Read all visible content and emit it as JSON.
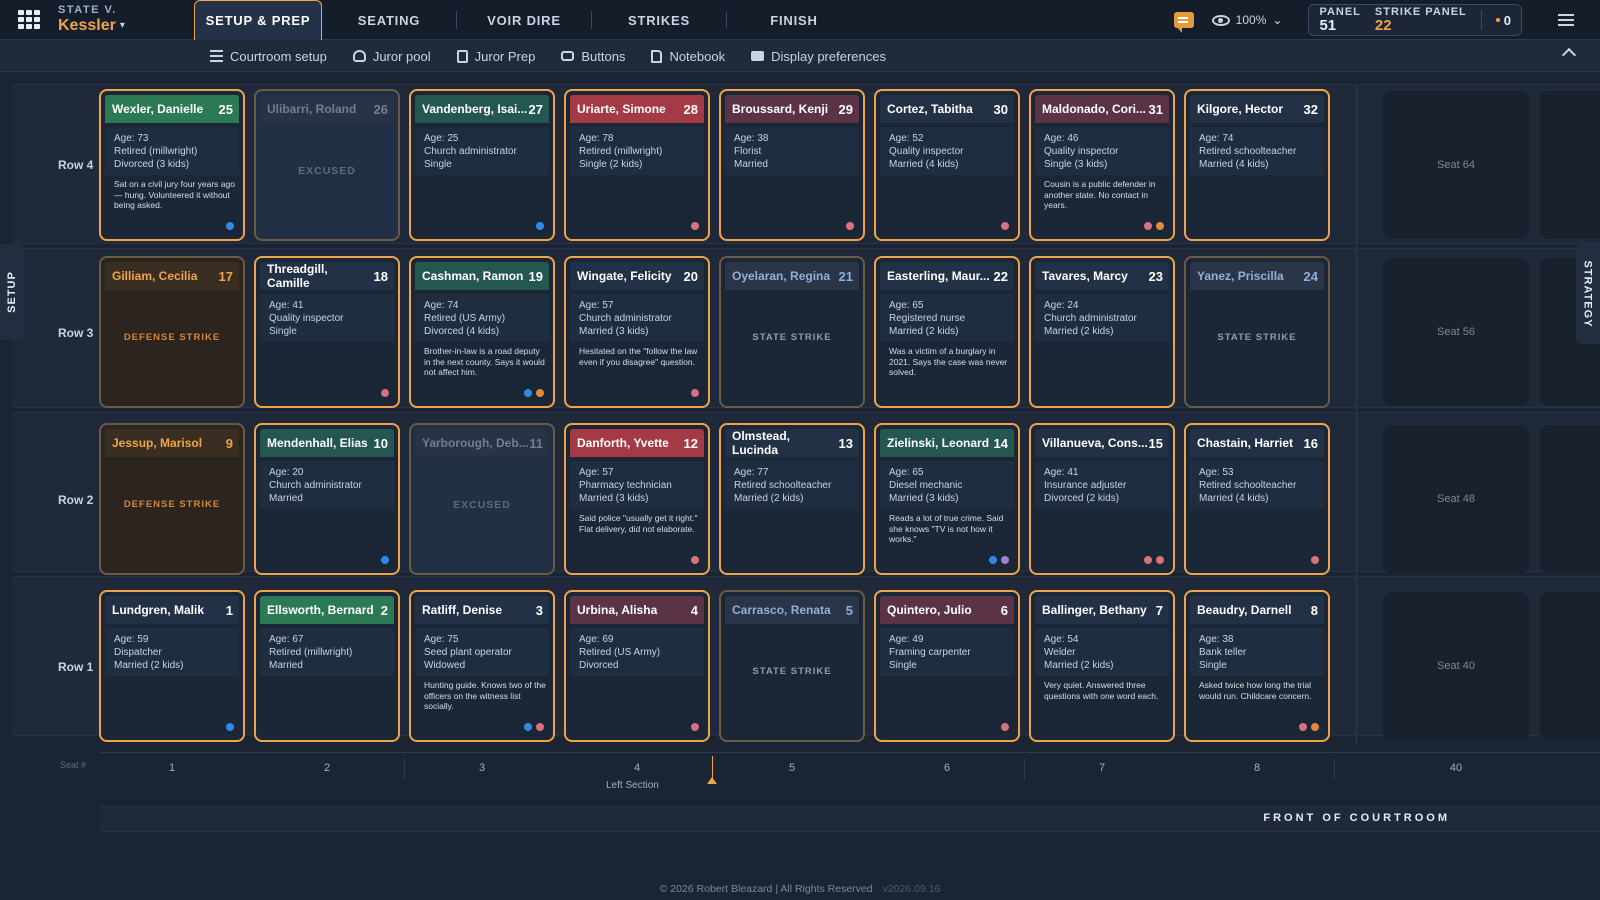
{
  "case": {
    "kicker": "STATE V.",
    "name": "Kessler"
  },
  "tabs": [
    {
      "label": "SETUP & PREP",
      "active": true
    },
    {
      "label": "SEATING"
    },
    {
      "label": "VOIR DIRE"
    },
    {
      "label": "STRIKES"
    },
    {
      "label": "FINISH"
    }
  ],
  "zoom": "100%",
  "panel": {
    "label": "PANEL",
    "value": "51",
    "strike_label": "STRIKE PANEL",
    "strike_value": "22",
    "count": "0"
  },
  "subnav": [
    "Courtroom setup",
    "Juror pool",
    "Juror Prep",
    "Buttons",
    "Notebook",
    "Display preferences"
  ],
  "side_left": "SETUP",
  "side_right": "STRATEGY",
  "rows": [
    "Row 4",
    "Row 3",
    "Row 2",
    "Row 1"
  ],
  "seats": {
    "row4": [
      {
        "name": "Wexler, Danielle",
        "num": "25",
        "color": "green",
        "age": "Age: 73",
        "job": "Retired (millwright)",
        "family": "Divorced (3 kids)",
        "note": "Sat on a civil jury four years ago — hung. Volunteered it without being asked.",
        "dots": [
          "#2f8be6"
        ]
      },
      {
        "name": "Ulibarri, Roland",
        "num": "26",
        "color": "muted",
        "status": "EXCUSED",
        "status_type": "excused"
      },
      {
        "name": "Vandenberg, Isai...",
        "num": "27",
        "color": "teal",
        "age": "Age: 25",
        "job": "Church administrator",
        "family": "Single",
        "note": "",
        "dots": [
          "#2f8be6"
        ]
      },
      {
        "name": "Uriarte, Simone",
        "num": "28",
        "color": "red",
        "age": "Age: 78",
        "job": "Retired (millwright)",
        "family": "Single (2 kids)",
        "note": "",
        "dots": [
          "#d9727f"
        ]
      },
      {
        "name": "Broussard, Kenji",
        "num": "29",
        "color": "rose",
        "age": "Age: 38",
        "job": "Florist",
        "family": "Married",
        "note": "",
        "dots": [
          "#d9727f"
        ]
      },
      {
        "name": "Cortez, Tabitha",
        "num": "30",
        "color": "default",
        "age": "Age: 52",
        "job": "Quality inspector",
        "family": "Married (4 kids)",
        "note": "",
        "dots": [
          "#d9727f"
        ]
      },
      {
        "name": "Maldonado, Cori...",
        "num": "31",
        "color": "rose",
        "age": "Age: 46",
        "job": "Quality inspector",
        "family": "Single (3 kids)",
        "note": "Cousin is a public defender in another state. No contact in years.",
        "dots": [
          "#d9727f",
          "#e08a3c"
        ]
      },
      {
        "name": "Kilgore, Hector",
        "num": "32",
        "color": "default",
        "age": "Age: 74",
        "job": "Retired schoolteacher",
        "family": "Married (4 kids)",
        "note": "",
        "dots": []
      }
    ],
    "row3": [
      {
        "name": "Gilliam, Cecilia",
        "num": "17",
        "color": "orange",
        "status": "DEFENSE STRIKE",
        "status_type": "defense"
      },
      {
        "name": "Threadgill, Camille",
        "num": "18",
        "color": "default",
        "age": "Age: 41",
        "job": "Quality inspector",
        "family": "Single",
        "note": "",
        "dots": [
          "#d9727f"
        ]
      },
      {
        "name": "Cashman, Ramon",
        "num": "19",
        "color": "teal",
        "age": "Age: 74",
        "job": "Retired (US Army)",
        "family": "Divorced (4 kids)",
        "note": "Brother-in-law is a road deputy in the next county. Says it would not affect him.",
        "dots": [
          "#2f8be6",
          "#e08a3c"
        ]
      },
      {
        "name": "Wingate, Felicity",
        "num": "20",
        "color": "default",
        "age": "Age: 57",
        "job": "Church administrator",
        "family": "Married (3 kids)",
        "note": "Hesitated on the \"follow the law even if you disagree\" question.",
        "dots": [
          "#d9727f"
        ]
      },
      {
        "name": "Oyelaran, Regina",
        "num": "21",
        "color": "gray",
        "status": "STATE STRIKE",
        "status_type": "state"
      },
      {
        "name": "Easterling, Maur...",
        "num": "22",
        "color": "default",
        "age": "Age: 65",
        "job": "Registered nurse",
        "family": "Married (2 kids)",
        "note": "Was a victim of a burglary in 2021. Says the case was never solved.",
        "dots": []
      },
      {
        "name": "Tavares, Marcy",
        "num": "23",
        "color": "default",
        "age": "Age: 24",
        "job": "Church administrator",
        "family": "Married (2 kids)",
        "note": "",
        "dots": []
      },
      {
        "name": "Yanez, Priscilla",
        "num": "24",
        "color": "gray",
        "status": "STATE STRIKE",
        "status_type": "state"
      }
    ],
    "row2": [
      {
        "name": "Jessup, Marisol",
        "num": "9",
        "color": "orange",
        "status": "DEFENSE STRIKE",
        "status_type": "defense"
      },
      {
        "name": "Mendenhall, Elias",
        "num": "10",
        "color": "teal",
        "age": "Age: 20",
        "job": "Church administrator",
        "family": "Married",
        "note": "",
        "dots": [
          "#2f8be6"
        ]
      },
      {
        "name": "Yarborough, Deb...",
        "num": "11",
        "color": "muted",
        "status": "EXCUSED",
        "status_type": "excused"
      },
      {
        "name": "Danforth, Yvette",
        "num": "12",
        "color": "red",
        "age": "Age: 57",
        "job": "Pharmacy technician",
        "family": "Married (3 kids)",
        "note": "Said police \"usually get it right.\" Flat delivery, did not elaborate.",
        "dots": [
          "#d9727f"
        ]
      },
      {
        "name": "Olmstead, Lucinda",
        "num": "13",
        "color": "default",
        "age": "Age: 77",
        "job": "Retired schoolteacher",
        "family": "Married (2 kids)",
        "note": "",
        "dots": []
      },
      {
        "name": "Zielinski, Leonard",
        "num": "14",
        "color": "teal",
        "age": "Age: 65",
        "job": "Diesel mechanic",
        "family": "Married (3 kids)",
        "note": "Reads a lot of true crime. Said she knows \"TV is not how it works.\"",
        "dots": [
          "#2f8be6",
          "#a57fd9"
        ]
      },
      {
        "name": "Villanueva, Cons...",
        "num": "15",
        "color": "default",
        "age": "Age: 41",
        "job": "Insurance adjuster",
        "family": "Divorced (2 kids)",
        "note": "",
        "dots": [
          "#d9727f",
          "#d9727f"
        ]
      },
      {
        "name": "Chastain, Harriet",
        "num": "16",
        "color": "default",
        "age": "Age: 53",
        "job": "Retired schoolteacher",
        "family": "Married (4 kids)",
        "note": "",
        "dots": [
          "#d9727f"
        ]
      }
    ],
    "row1": [
      {
        "name": "Lundgren, Malik",
        "num": "1",
        "color": "default",
        "age": "Age: 59",
        "job": "Dispatcher",
        "family": "Married (2 kids)",
        "note": "",
        "dots": [
          "#2f8be6"
        ]
      },
      {
        "name": "Ellsworth, Bernard",
        "num": "2",
        "color": "green",
        "age": "Age: 67",
        "job": "Retired (millwright)",
        "family": "Married",
        "note": "",
        "dots": []
      },
      {
        "name": "Ratliff, Denise",
        "num": "3",
        "color": "default",
        "age": "Age: 75",
        "job": "Seed plant operator",
        "family": "Widowed",
        "note": "Hunting guide. Knows two of the officers on the witness list socially.",
        "dots": [
          "#2f8be6",
          "#d9727f"
        ]
      },
      {
        "name": "Urbina, Alisha",
        "num": "4",
        "color": "rose",
        "age": "Age: 69",
        "job": "Retired (US Army)",
        "family": "Divorced",
        "note": "",
        "dots": [
          "#d9727f"
        ]
      },
      {
        "name": "Carrasco, Renata",
        "num": "5",
        "color": "gray",
        "status": "STATE STRIKE",
        "status_type": "state"
      },
      {
        "name": "Quintero, Julio",
        "num": "6",
        "color": "rose",
        "age": "Age: 49",
        "job": "Framing carpenter",
        "family": "Single",
        "note": "",
        "dots": [
          "#d9727f"
        ]
      },
      {
        "name": "Ballinger, Bethany",
        "num": "7",
        "color": "default",
        "age": "Age: 54",
        "job": "Welder",
        "family": "Married (2 kids)",
        "note": "Very quiet. Answered three questions with one word each.",
        "dots": []
      },
      {
        "name": "Beaudry, Darnell",
        "num": "8",
        "color": "default",
        "age": "Age: 38",
        "job": "Bank teller",
        "family": "Single",
        "note": "Asked twice how long the trial would run. Childcare concern.",
        "dots": [
          "#d9727f",
          "#e08a3c"
        ]
      }
    ]
  },
  "empty_seats": [
    "Seat 64",
    "Seat 56",
    "Seat 48",
    "Seat 40"
  ],
  "axis": {
    "label": "Seat #",
    "numbers": [
      "1",
      "2",
      "3",
      "4",
      "5",
      "6",
      "7",
      "8",
      "40"
    ],
    "section": "Left Section"
  },
  "front": "FRONT OF COURTROOM",
  "footer": {
    "copyright": "© 2026 Robert Bleazard | All Rights Reserved",
    "version": "v2026.09.16"
  }
}
